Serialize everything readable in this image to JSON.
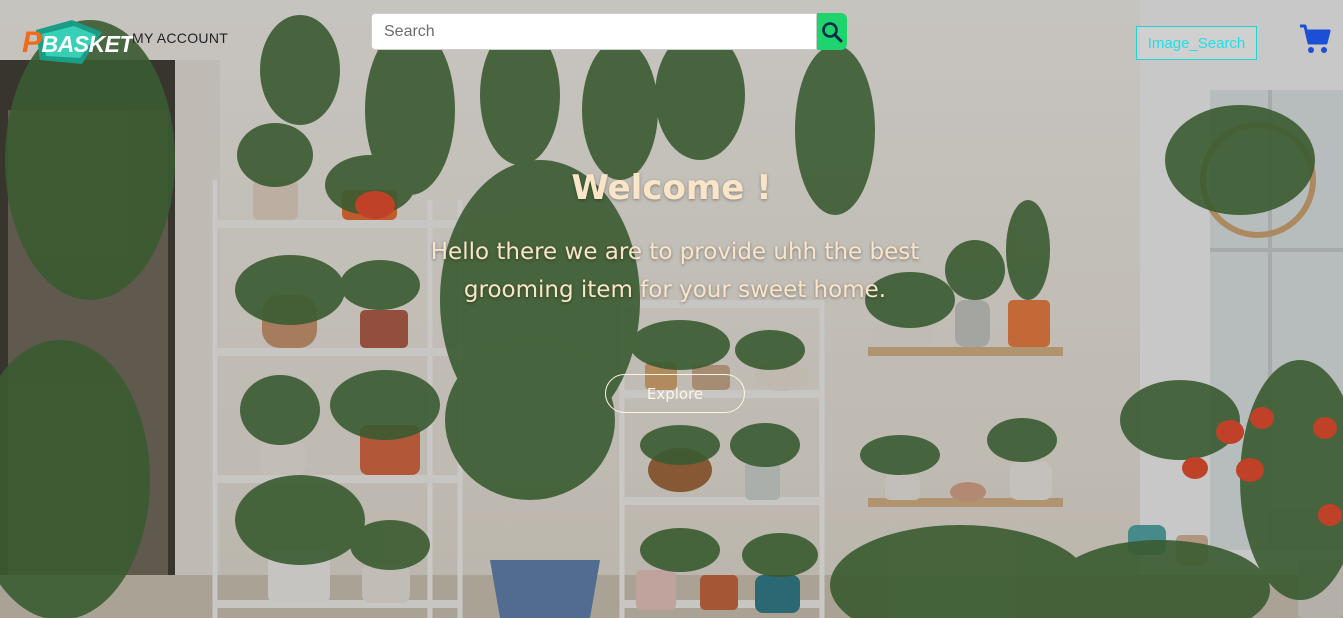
{
  "nav": {
    "logo_text_first": "P",
    "logo_text_rest": "BASKET",
    "account_label": "MY ACCOUNT",
    "search_placeholder": "Search",
    "search_value": "",
    "image_search_label": "Image_Search",
    "cart_icon": "shopping-cart-icon",
    "search_icon": "magnifier-icon"
  },
  "hero": {
    "title": "Welcome !",
    "subtitle": "Hello there we are to provide uhh the best grooming item for your sweet home.",
    "cta_label": "Explore"
  },
  "colors": {
    "search_button": "#1fd46c",
    "image_search_accent": "#1ee0e8",
    "cart": "#1d4fd6",
    "hero_text": "#fbe5c9",
    "logo_teal": "#2fc7b0",
    "logo_orange": "#f26a1b"
  }
}
